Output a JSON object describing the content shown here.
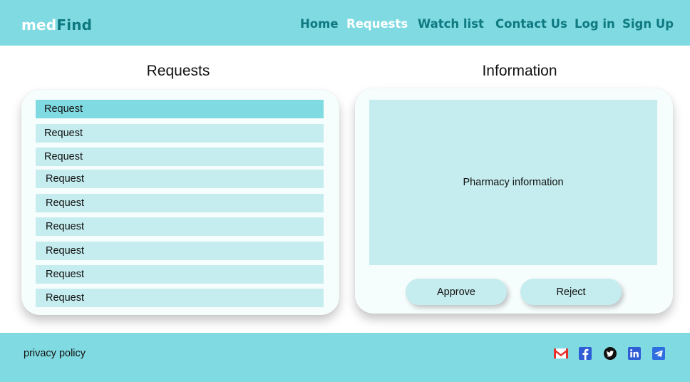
{
  "header": {
    "logo_part_a": "med",
    "logo_part_b": "Find",
    "nav": [
      "Home",
      "Requests",
      "Watch list",
      "Contact Us",
      "Log in",
      "Sign Up"
    ],
    "active_nav": "Requests"
  },
  "requests_panel": {
    "title": "Requests",
    "items": [
      "Request",
      "Request",
      "Request",
      "Request",
      "Request",
      "Request",
      "Request",
      "Request",
      "Request"
    ],
    "selected_index": 0
  },
  "info_panel": {
    "title": "Information",
    "content": "Pharmacy information",
    "approve_label": "Approve",
    "reject_label": "Reject"
  },
  "footer": {
    "privacy_label": "privacy policy",
    "social_icons": [
      "gmail-icon",
      "facebook-icon",
      "twitter-icon",
      "linkedin-icon",
      "telegram-icon"
    ]
  },
  "colors": {
    "primary": "#80dae1",
    "light": "#c5ecee",
    "accent": "#0e7980"
  }
}
